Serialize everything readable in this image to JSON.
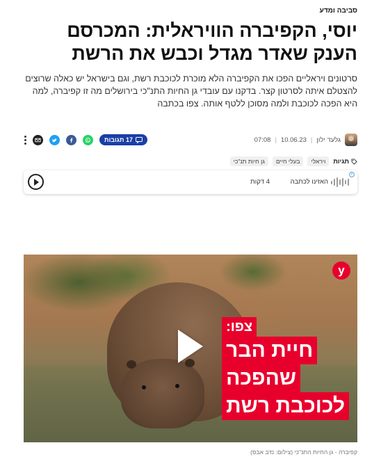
{
  "article": {
    "category": "סביבה ומדע",
    "headline": "יוסי, הקפיברה הוויראלית: המכרסם הענק שאדר מגדל וכבש את הרשת",
    "subtitle": "סרטונים ויראליים הפכו את הקפיברה הלא מוכרת לכוכבת רשת, וגם בישראל יש כאלה שרוצים להצטלם איתה לסרטון קצר. בדקנו עם עובדי גן החיות התנ\"כי בירושלים מה זו קפיברה, למה היא הפכה לכוכבת ולמה מסוכן ללטף אותה. צפו בכתבה"
  },
  "meta": {
    "author": "גלעד ילון",
    "date": "10.06.23",
    "time": "07:08",
    "separator": "|",
    "comments_label": "17 תגובות"
  },
  "share": {
    "icons": [
      "more-icon",
      "mail-icon",
      "twitter-icon",
      "facebook-icon",
      "whatsapp-icon"
    ]
  },
  "tags": {
    "label": "תגיות",
    "items": [
      "ויראלי",
      "בעלי חיים",
      "גן חיות תנ\"כי"
    ]
  },
  "audio": {
    "label": "האזינו לכתבה",
    "duration": "4 דקות",
    "info_glyph": "i"
  },
  "video": {
    "logo_letter": "y",
    "caption_line1": "צפו:",
    "caption_line2": "חיית הבר",
    "caption_line3": "שהפכה",
    "caption_line4": "לכוכבת רשת"
  },
  "photo_credit": "קפיברה - גן החיות התנ\"כי   (צילום: נדב אבס)",
  "colors": {
    "accent_blue": "#1a3fa6",
    "brand_red": "#e8002d",
    "whatsapp": "#25d366",
    "facebook": "#3b5998",
    "twitter": "#1da1f2"
  }
}
